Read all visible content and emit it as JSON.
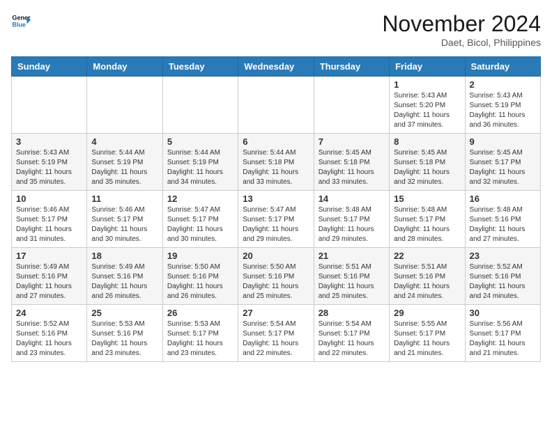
{
  "header": {
    "logo_line1": "General",
    "logo_line2": "Blue",
    "month": "November 2024",
    "location": "Daet, Bicol, Philippines"
  },
  "weekdays": [
    "Sunday",
    "Monday",
    "Tuesday",
    "Wednesday",
    "Thursday",
    "Friday",
    "Saturday"
  ],
  "weeks": [
    [
      {
        "day": "",
        "info": ""
      },
      {
        "day": "",
        "info": ""
      },
      {
        "day": "",
        "info": ""
      },
      {
        "day": "",
        "info": ""
      },
      {
        "day": "",
        "info": ""
      },
      {
        "day": "1",
        "info": "Sunrise: 5:43 AM\nSunset: 5:20 PM\nDaylight: 11 hours\nand 37 minutes."
      },
      {
        "day": "2",
        "info": "Sunrise: 5:43 AM\nSunset: 5:19 PM\nDaylight: 11 hours\nand 36 minutes."
      }
    ],
    [
      {
        "day": "3",
        "info": "Sunrise: 5:43 AM\nSunset: 5:19 PM\nDaylight: 11 hours\nand 35 minutes."
      },
      {
        "day": "4",
        "info": "Sunrise: 5:44 AM\nSunset: 5:19 PM\nDaylight: 11 hours\nand 35 minutes."
      },
      {
        "day": "5",
        "info": "Sunrise: 5:44 AM\nSunset: 5:19 PM\nDaylight: 11 hours\nand 34 minutes."
      },
      {
        "day": "6",
        "info": "Sunrise: 5:44 AM\nSunset: 5:18 PM\nDaylight: 11 hours\nand 33 minutes."
      },
      {
        "day": "7",
        "info": "Sunrise: 5:45 AM\nSunset: 5:18 PM\nDaylight: 11 hours\nand 33 minutes."
      },
      {
        "day": "8",
        "info": "Sunrise: 5:45 AM\nSunset: 5:18 PM\nDaylight: 11 hours\nand 32 minutes."
      },
      {
        "day": "9",
        "info": "Sunrise: 5:45 AM\nSunset: 5:17 PM\nDaylight: 11 hours\nand 32 minutes."
      }
    ],
    [
      {
        "day": "10",
        "info": "Sunrise: 5:46 AM\nSunset: 5:17 PM\nDaylight: 11 hours\nand 31 minutes."
      },
      {
        "day": "11",
        "info": "Sunrise: 5:46 AM\nSunset: 5:17 PM\nDaylight: 11 hours\nand 30 minutes."
      },
      {
        "day": "12",
        "info": "Sunrise: 5:47 AM\nSunset: 5:17 PM\nDaylight: 11 hours\nand 30 minutes."
      },
      {
        "day": "13",
        "info": "Sunrise: 5:47 AM\nSunset: 5:17 PM\nDaylight: 11 hours\nand 29 minutes."
      },
      {
        "day": "14",
        "info": "Sunrise: 5:48 AM\nSunset: 5:17 PM\nDaylight: 11 hours\nand 29 minutes."
      },
      {
        "day": "15",
        "info": "Sunrise: 5:48 AM\nSunset: 5:17 PM\nDaylight: 11 hours\nand 28 minutes."
      },
      {
        "day": "16",
        "info": "Sunrise: 5:48 AM\nSunset: 5:16 PM\nDaylight: 11 hours\nand 27 minutes."
      }
    ],
    [
      {
        "day": "17",
        "info": "Sunrise: 5:49 AM\nSunset: 5:16 PM\nDaylight: 11 hours\nand 27 minutes."
      },
      {
        "day": "18",
        "info": "Sunrise: 5:49 AM\nSunset: 5:16 PM\nDaylight: 11 hours\nand 26 minutes."
      },
      {
        "day": "19",
        "info": "Sunrise: 5:50 AM\nSunset: 5:16 PM\nDaylight: 11 hours\nand 26 minutes."
      },
      {
        "day": "20",
        "info": "Sunrise: 5:50 AM\nSunset: 5:16 PM\nDaylight: 11 hours\nand 25 minutes."
      },
      {
        "day": "21",
        "info": "Sunrise: 5:51 AM\nSunset: 5:16 PM\nDaylight: 11 hours\nand 25 minutes."
      },
      {
        "day": "22",
        "info": "Sunrise: 5:51 AM\nSunset: 5:16 PM\nDaylight: 11 hours\nand 24 minutes."
      },
      {
        "day": "23",
        "info": "Sunrise: 5:52 AM\nSunset: 5:16 PM\nDaylight: 11 hours\nand 24 minutes."
      }
    ],
    [
      {
        "day": "24",
        "info": "Sunrise: 5:52 AM\nSunset: 5:16 PM\nDaylight: 11 hours\nand 23 minutes."
      },
      {
        "day": "25",
        "info": "Sunrise: 5:53 AM\nSunset: 5:16 PM\nDaylight: 11 hours\nand 23 minutes."
      },
      {
        "day": "26",
        "info": "Sunrise: 5:53 AM\nSunset: 5:17 PM\nDaylight: 11 hours\nand 23 minutes."
      },
      {
        "day": "27",
        "info": "Sunrise: 5:54 AM\nSunset: 5:17 PM\nDaylight: 11 hours\nand 22 minutes."
      },
      {
        "day": "28",
        "info": "Sunrise: 5:54 AM\nSunset: 5:17 PM\nDaylight: 11 hours\nand 22 minutes."
      },
      {
        "day": "29",
        "info": "Sunrise: 5:55 AM\nSunset: 5:17 PM\nDaylight: 11 hours\nand 21 minutes."
      },
      {
        "day": "30",
        "info": "Sunrise: 5:56 AM\nSunset: 5:17 PM\nDaylight: 11 hours\nand 21 minutes."
      }
    ]
  ]
}
